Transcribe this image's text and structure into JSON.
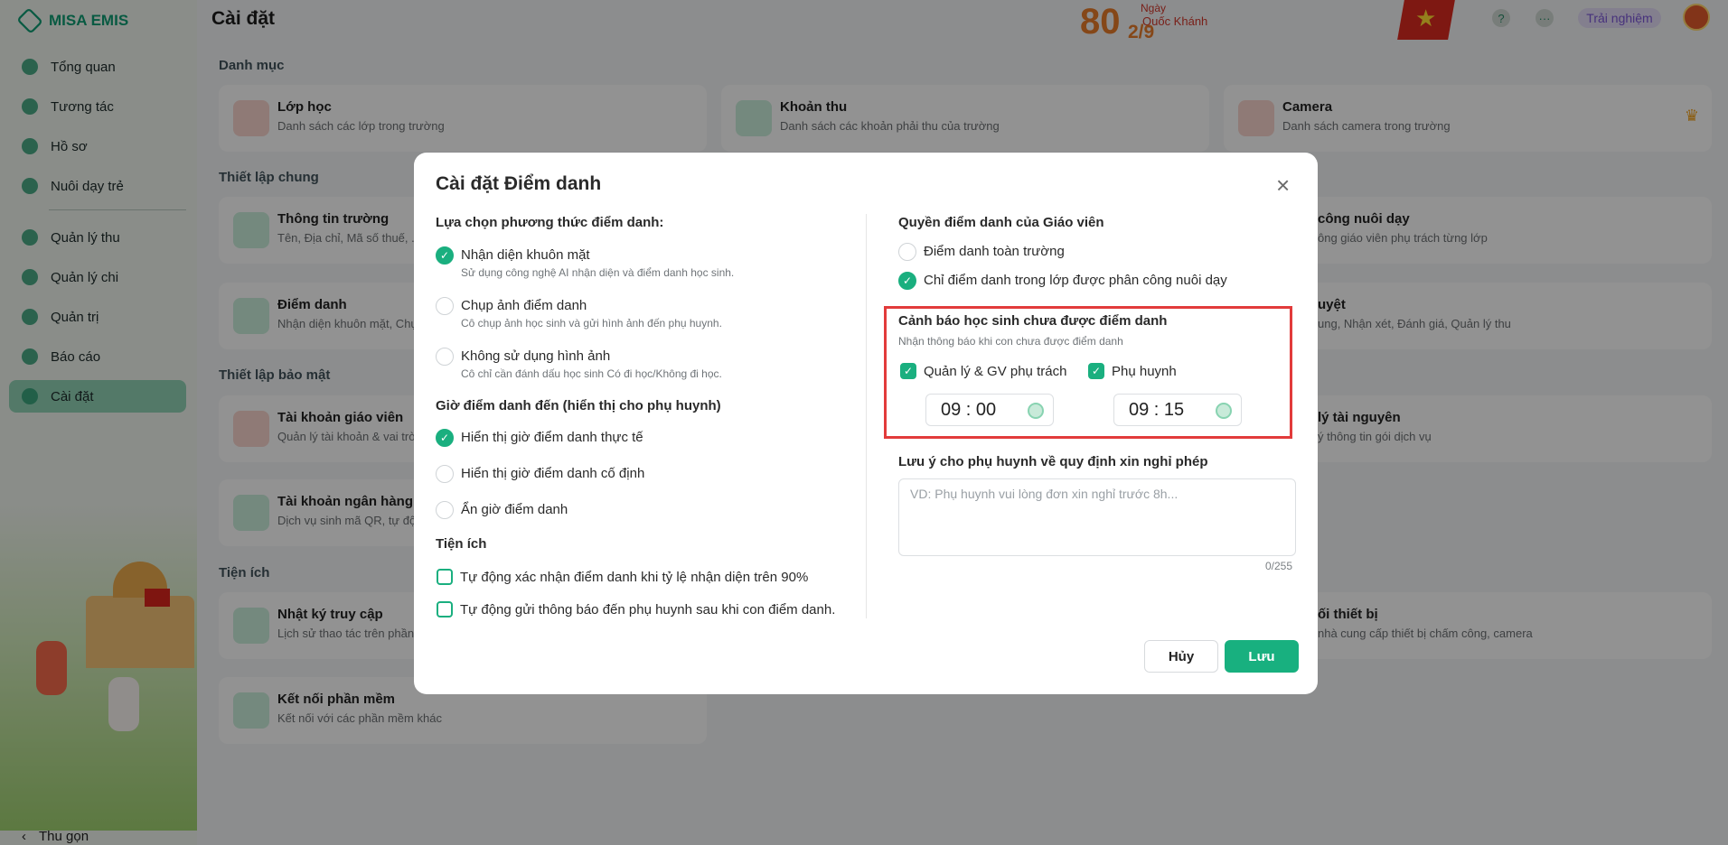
{
  "app": {
    "logo_text": "MISA EMIS",
    "brand_color": "#0f9b72"
  },
  "header": {
    "page_title": "Cài đặt",
    "banner_number": "80",
    "banner_day_label": "Ngày",
    "banner_holiday": "Quốc Khánh",
    "banner_date": "2/9",
    "help_icon": "?",
    "more_icon": "···",
    "trial_label": "Trải nghiệm"
  },
  "sidebar": {
    "items": [
      {
        "label": "Tổng quan",
        "icon": "pie-chart-icon"
      },
      {
        "label": "Tương tác",
        "icon": "send-icon"
      },
      {
        "label": "Hồ sơ",
        "icon": "folder-icon"
      },
      {
        "label": "Nuôi dạy trẻ",
        "icon": "heart-icon"
      },
      {
        "label": "Quản lý thu",
        "icon": "trend-icon"
      },
      {
        "label": "Quản lý chi",
        "icon": "wallet-icon"
      },
      {
        "label": "Quản trị",
        "icon": "briefcase-icon"
      },
      {
        "label": "Báo cáo",
        "icon": "bar-chart-icon"
      },
      {
        "label": "Cài đặt",
        "icon": "settings-icon",
        "active": true
      }
    ],
    "collapse_label": "Thu gọn"
  },
  "main": {
    "sections": {
      "danh_muc": "Danh mục",
      "thiet_lap_chung": "Thiết lập chung",
      "thiet_lap_bao_mat": "Thiết lập bảo mật",
      "tien_ich": "Tiện ích"
    },
    "cards": {
      "lop_hoc": {
        "title": "Lớp học",
        "desc": "Danh sách các lớp trong trường"
      },
      "khoan_thu": {
        "title": "Khoản thu",
        "desc": "Danh sách các khoản phải thu của trường"
      },
      "camera": {
        "title": "Camera",
        "desc": "Danh sách camera trong trường"
      },
      "thong_tin_truong": {
        "title": "Thông tin trường",
        "desc": "Tên, Địa chỉ, Mã số thuế, ..."
      },
      "phan_cong": {
        "title": "công nuôi dạy",
        "desc": "ông giáo viên phụ trách từng lớp"
      },
      "diem_danh": {
        "title": "Điểm danh",
        "desc": "Nhận diện khuôn mặt, Chụ"
      },
      "ren_luyen": {
        "title": "uyệt",
        "desc": "ung, Nhận xét, Đánh giá, Quản lý thu"
      },
      "tk_giao_vien": {
        "title": "Tài khoản giáo viên",
        "desc": "Quản lý tài khoản & vai trò"
      },
      "tai_nguyen": {
        "title": "lý tài nguyên",
        "desc": "ý thông tin gói dịch vụ"
      },
      "tk_ngan_hang": {
        "title": "Tài khoản ngân hàng",
        "desc": "Dịch vụ sinh mã QR, tự độn"
      },
      "nhat_ky": {
        "title": "Nhật ký truy cập",
        "desc": "Lịch sử thao tác trên phần"
      },
      "thiet_bi": {
        "title": "ối thiết bị",
        "desc": "nhà cung cấp thiết bị chấm công, camera"
      },
      "ket_noi": {
        "title": "Kết nối phần mềm",
        "desc": "Kết nối với các phần mềm khác"
      }
    }
  },
  "modal": {
    "title": "Cài đặt Điểm danh",
    "close_icon": "×",
    "left": {
      "method_title": "Lựa chọn phương thức điểm danh:",
      "methods": [
        {
          "label": "Nhận diện khuôn mặt",
          "sub": "Sử dụng công nghệ AI nhận diện và điểm danh học sinh.",
          "checked": true
        },
        {
          "label": "Chụp ảnh điểm danh",
          "sub": "Cô chụp ảnh học sinh và gửi hình ảnh đến phụ huynh.",
          "checked": false
        },
        {
          "label": "Không sử dụng hình ảnh",
          "sub": "Cô chỉ cần đánh dấu học sinh Có đi học/Không đi học.",
          "checked": false
        }
      ],
      "time_title": "Giờ điểm danh đến (hiển thị cho phụ huynh)",
      "time_options": [
        {
          "label": "Hiển thị giờ điểm danh thực tế",
          "checked": true
        },
        {
          "label": "Hiển thị giờ điểm danh cố định",
          "checked": false
        },
        {
          "label": "Ẩn giờ điểm danh",
          "checked": false
        }
      ],
      "utility_title": "Tiện ích",
      "utilities": [
        {
          "label": "Tự động xác nhận điểm danh khi tỷ lệ nhận diện trên 90%",
          "checked": false
        },
        {
          "label": "Tự động gửi thông báo đến phụ huynh sau khi con điểm danh.",
          "checked": false
        }
      ]
    },
    "right": {
      "rights_title": "Quyền điểm danh của Giáo viên",
      "rights": [
        {
          "label": "Điểm danh toàn trường",
          "checked": false
        },
        {
          "label": "Chỉ điểm danh trong lớp được phân công nuôi dạy",
          "checked": true
        }
      ],
      "warning_title": "Cảnh báo học sinh chưa được điểm danh",
      "warning_sub": "Nhận thông báo khi con chưa được điểm danh",
      "warning_manager_label": "Quản lý & GV phụ trách",
      "warning_parent_label": "Phụ huynh",
      "manager_time": "09 : 00",
      "parent_time": "09 : 15",
      "note_title": "Lưu ý cho phụ huynh về quy định xin nghỉ phép",
      "note_placeholder": "VD: Phụ huynh vui lòng đơn xin nghỉ trước 8h...",
      "note_counter": "0/255"
    },
    "cancel_label": "Hủy",
    "save_label": "Lưu"
  }
}
